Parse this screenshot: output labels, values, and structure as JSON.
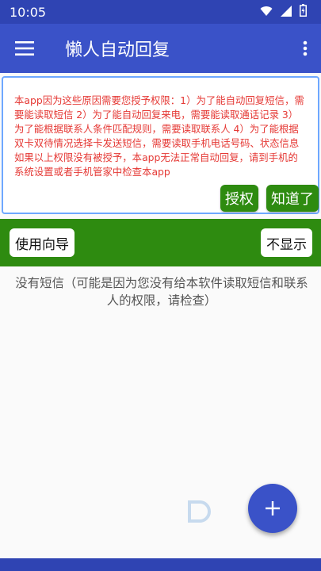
{
  "status_bar": {
    "time": "10:05",
    "icons": [
      "wifi-icon",
      "signal-icon",
      "battery-icon"
    ]
  },
  "app_bar": {
    "title": "懒人自动回复",
    "icons": [
      "menu-icon",
      "more-vert-icon"
    ]
  },
  "permission_card": {
    "text": "本app因为这些原因需要您授予权限：1）为了能自动回复短信，需要能读取短信 2）为了能自动回复来电，需要能读取通话记录 3）为了能根据联系人条件匹配规则，需要读取联系人 4）为了能根据双卡双待情况选择卡发送短信，需要读取手机电话号码、状态信息 如果以上权限没有被授予，本app无法正常自动回复，请到手机的系统设置或者手机管家中检查本app",
    "grant_label": "授权",
    "ok_label": "知道了"
  },
  "guide_bar": {
    "guide_label": "使用向导",
    "hide_label": "不显示"
  },
  "empty_message": "没有短信（可能是因为您没有给本软件读取短信和联系人的权限，请检查）",
  "fab": {
    "icon": "plus-icon"
  },
  "colors": {
    "primary": "#3a52c8",
    "status_bar": "#2f44b3",
    "green": "#2e8b10",
    "warning_text": "#e53935"
  }
}
